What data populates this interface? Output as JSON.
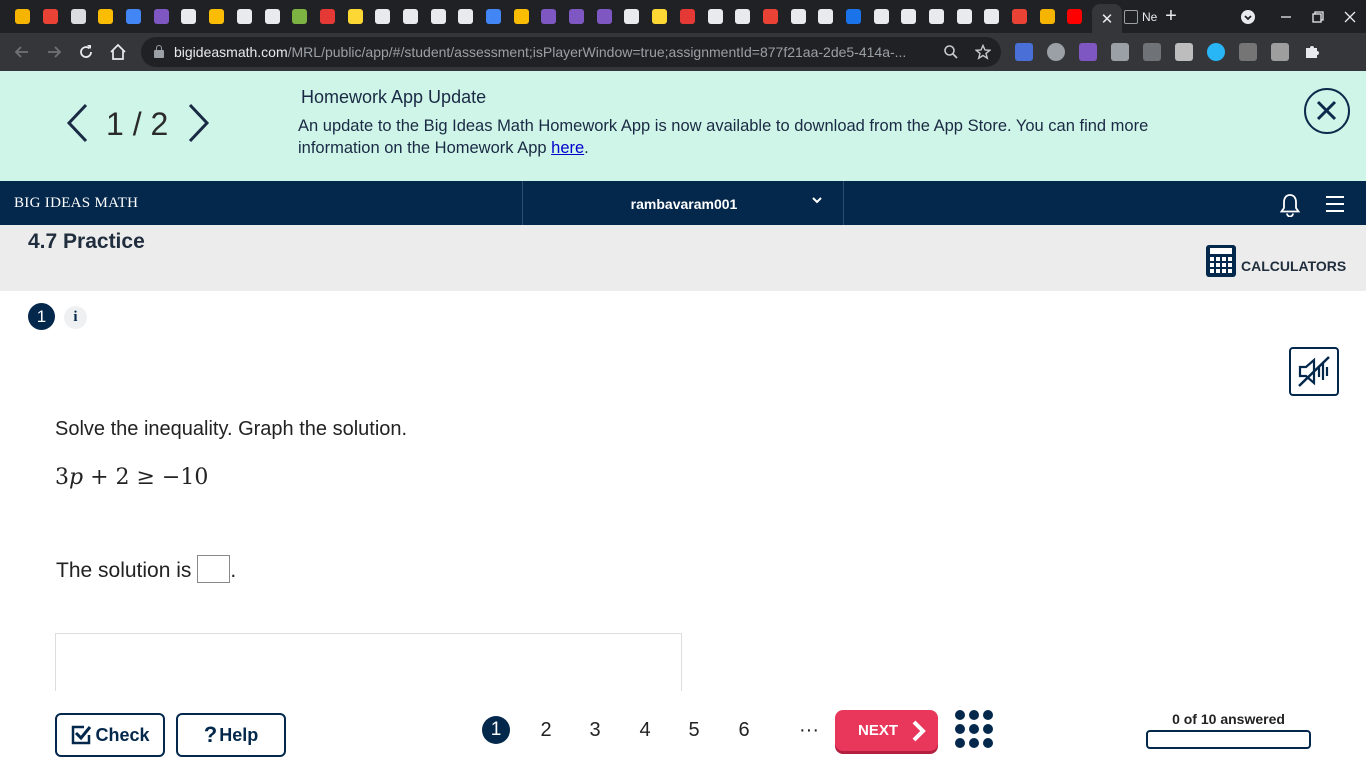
{
  "browser": {
    "tab_favicon_colors": [
      "#f4b400",
      "#ea4335",
      "#dadce0",
      "#fbbc04",
      "#4285f4",
      "#7e57c2",
      "#e8eaed",
      "#fbbc04",
      "#e8eaed",
      "#e8eaed",
      "#7cb342",
      "#e53935",
      "#fdd835",
      "#e8eaed",
      "#e8eaed",
      "#e8eaed",
      "#e8eaed",
      "#4285f4",
      "#fbbc04",
      "#7e57c2",
      "#7e57c2",
      "#7e57c2",
      "#e8eaed",
      "#fdd835",
      "#e53935",
      "#e8eaed",
      "#e8eaed",
      "#ea4335",
      "#e8eaed",
      "#e8eaed",
      "#1a73e8",
      "#e8eaed",
      "#e8eaed",
      "#e8eaed",
      "#e8eaed",
      "#e8eaed",
      "#ea4335",
      "#f4b400",
      "#ff0000",
      "#00a86b"
    ],
    "active_tab_close": "✕",
    "last_tab_label": "Ne",
    "new_tab": "+",
    "url_host": "bigideasmath.com",
    "url_path": "/MRL/public/app/#/student/assessment;isPlayerWindow=true;assignmentId=877f21aa-2de5-414a-..."
  },
  "banner": {
    "page_indicator": "1 / 2",
    "title": "Homework App Update",
    "text": "An update to the Big Ideas Math Homework App is now available to download from the App Store. You can find more information on the Homework App ",
    "link": "here",
    "text_end": "."
  },
  "header": {
    "brand": "BIG IDEAS MATH",
    "username": "rambavaram001"
  },
  "section": {
    "title": "4.7 Practice",
    "calculators_label": "CALCULATORS"
  },
  "question": {
    "number": "1",
    "info": "i",
    "prompt": "Solve the inequality. Graph the solution.",
    "math_coef": "3",
    "math_var": "p",
    "math_rest": " + 2 ≥ −10",
    "answer_prefix": "The solution is",
    "answer_suffix": "."
  },
  "footer": {
    "check_label": "Check",
    "help_label": "Help",
    "pages": [
      "1",
      "2",
      "3",
      "4",
      "5",
      "6"
    ],
    "current_page": "1",
    "more": "···",
    "next_label": "NEXT",
    "progress_text": "0 of 10 answered",
    "answered": 0,
    "total": 10
  },
  "colors": {
    "navy": "#04284c",
    "banner_bg": "#cff5e8",
    "next_red": "#e8375b"
  }
}
